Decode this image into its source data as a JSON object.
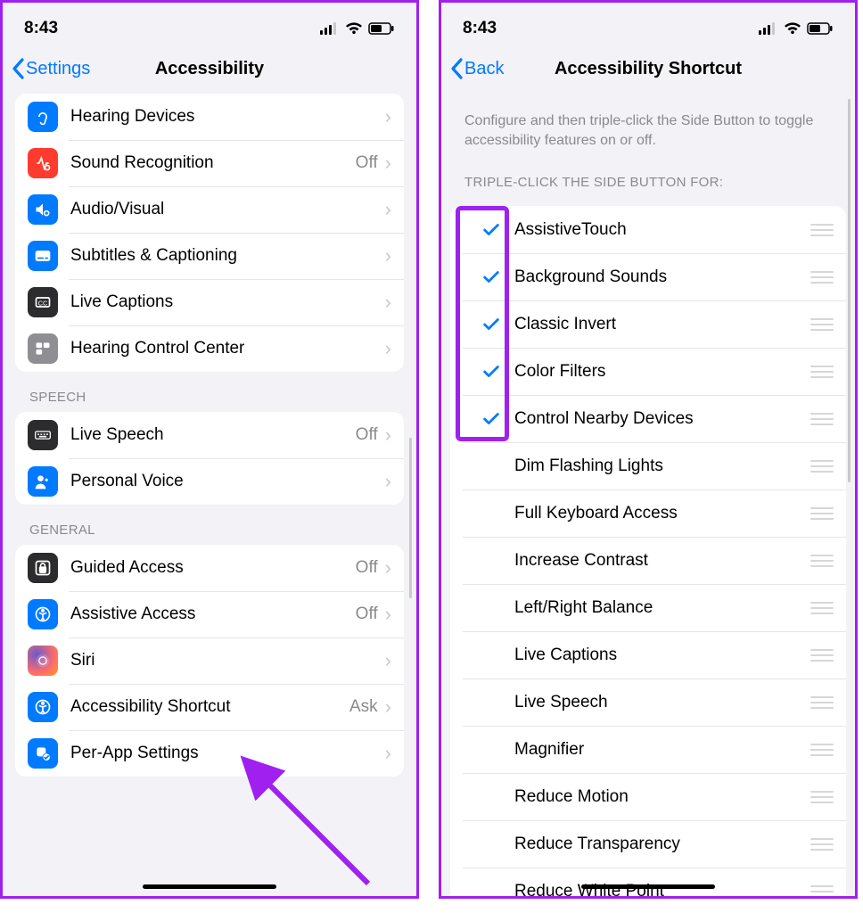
{
  "status": {
    "time": "8:43"
  },
  "left": {
    "back_label": "Settings",
    "title": "Accessibility",
    "groups": [
      {
        "header": "",
        "items": [
          {
            "name": "hearing-devices",
            "icon": "ear-icon",
            "color": "bg-blue",
            "label": "Hearing Devices",
            "value": ""
          },
          {
            "name": "sound-recognition",
            "icon": "sound-rec-icon",
            "color": "bg-red",
            "label": "Sound Recognition",
            "value": "Off"
          },
          {
            "name": "audio-visual",
            "icon": "audio-visual-icon",
            "color": "bg-blue",
            "label": "Audio/Visual",
            "value": ""
          },
          {
            "name": "subtitles-captioning",
            "icon": "subtitles-icon",
            "color": "bg-blue",
            "label": "Subtitles & Captioning",
            "value": ""
          },
          {
            "name": "live-captions",
            "icon": "live-captions-icon",
            "color": "bg-dark",
            "label": "Live Captions",
            "value": ""
          },
          {
            "name": "hearing-control-center",
            "icon": "hearing-cc-icon",
            "color": "bg-gray",
            "label": "Hearing Control Center",
            "value": ""
          }
        ]
      },
      {
        "header": "Speech",
        "items": [
          {
            "name": "live-speech",
            "icon": "keyboard-icon",
            "color": "bg-dark",
            "label": "Live Speech",
            "value": "Off"
          },
          {
            "name": "personal-voice",
            "icon": "personal-voice-icon",
            "color": "bg-blue",
            "label": "Personal Voice",
            "value": ""
          }
        ]
      },
      {
        "header": "General",
        "items": [
          {
            "name": "guided-access",
            "icon": "lock-icon",
            "color": "bg-dark",
            "label": "Guided Access",
            "value": "Off"
          },
          {
            "name": "assistive-access",
            "icon": "assistive-access-icon",
            "color": "bg-blue",
            "label": "Assistive Access",
            "value": "Off"
          },
          {
            "name": "siri",
            "icon": "siri-icon",
            "color": "bg-grad",
            "label": "Siri",
            "value": ""
          },
          {
            "name": "accessibility-shortcut",
            "icon": "accessibility-icon",
            "color": "bg-blue",
            "label": "Accessibility Shortcut",
            "value": "Ask"
          },
          {
            "name": "per-app-settings",
            "icon": "per-app-icon",
            "color": "bg-blue",
            "label": "Per-App Settings",
            "value": ""
          }
        ]
      }
    ]
  },
  "right": {
    "back_label": "Back",
    "title": "Accessibility Shortcut",
    "description": "Configure and then triple-click the Side Button to toggle accessibility features on or off.",
    "list_header": "Triple-click the Side Button for:",
    "items": [
      {
        "label": "AssistiveTouch",
        "checked": true
      },
      {
        "label": "Background Sounds",
        "checked": true
      },
      {
        "label": "Classic Invert",
        "checked": true
      },
      {
        "label": "Color Filters",
        "checked": true
      },
      {
        "label": "Control Nearby Devices",
        "checked": true
      },
      {
        "label": "Dim Flashing Lights",
        "checked": false
      },
      {
        "label": "Full Keyboard Access",
        "checked": false
      },
      {
        "label": "Increase Contrast",
        "checked": false
      },
      {
        "label": "Left/Right Balance",
        "checked": false
      },
      {
        "label": "Live Captions",
        "checked": false
      },
      {
        "label": "Live Speech",
        "checked": false
      },
      {
        "label": "Magnifier",
        "checked": false
      },
      {
        "label": "Reduce Motion",
        "checked": false
      },
      {
        "label": "Reduce Transparency",
        "checked": false
      },
      {
        "label": "Reduce White Point",
        "checked": false
      }
    ]
  },
  "annotations": {
    "highlight_color": "#a020f0",
    "arrow_color": "#a020f0"
  }
}
